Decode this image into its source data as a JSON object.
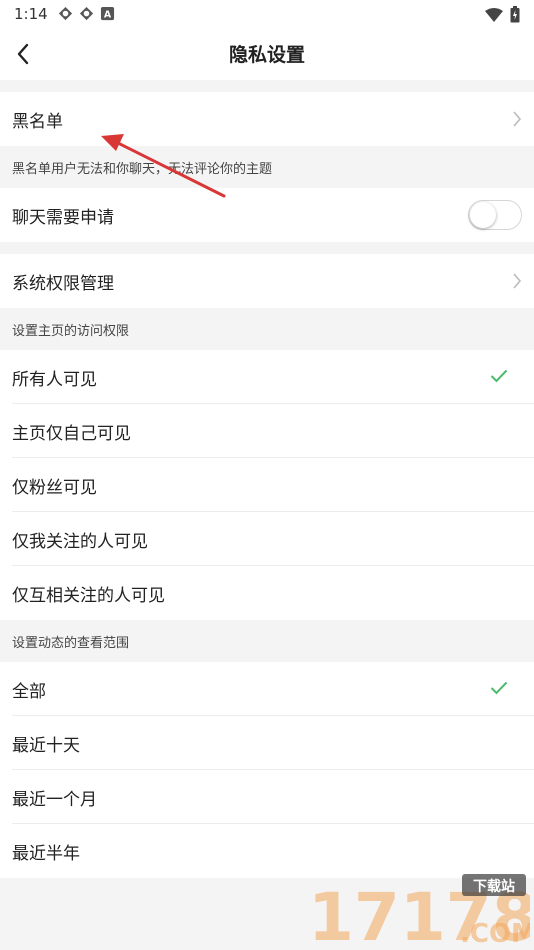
{
  "status_bar": {
    "time": "1:14",
    "badge_letter": "A"
  },
  "header": {
    "title": "隐私设置"
  },
  "blacklist": {
    "label": "黑名单",
    "description": "黑名单用户无法和你聊天，无法评论你的主题"
  },
  "chat_request": {
    "label": "聊天需要申请",
    "enabled": false
  },
  "system_permissions": {
    "label": "系统权限管理"
  },
  "homepage_visibility": {
    "section_title": "设置主页的访问权限",
    "options": [
      {
        "label": "所有人可见",
        "selected": true
      },
      {
        "label": "主页仅自己可见",
        "selected": false
      },
      {
        "label": "仅粉丝可见",
        "selected": false
      },
      {
        "label": "仅我关注的人可见",
        "selected": false
      },
      {
        "label": "仅互相关注的人可见",
        "selected": false
      }
    ]
  },
  "moments_range": {
    "section_title": "设置动态的查看范围",
    "options": [
      {
        "label": "全部",
        "selected": true
      },
      {
        "label": "最近十天",
        "selected": false
      },
      {
        "label": "最近一个月",
        "selected": false
      },
      {
        "label": "最近半年",
        "selected": false
      }
    ]
  },
  "watermark": {
    "digits": "17178",
    "tag": "下载站",
    "domain": ".COM"
  },
  "colors": {
    "accent_check": "#4cbb6c",
    "annotation_arrow": "#d93636",
    "watermark_orange": "#f2a65a"
  }
}
